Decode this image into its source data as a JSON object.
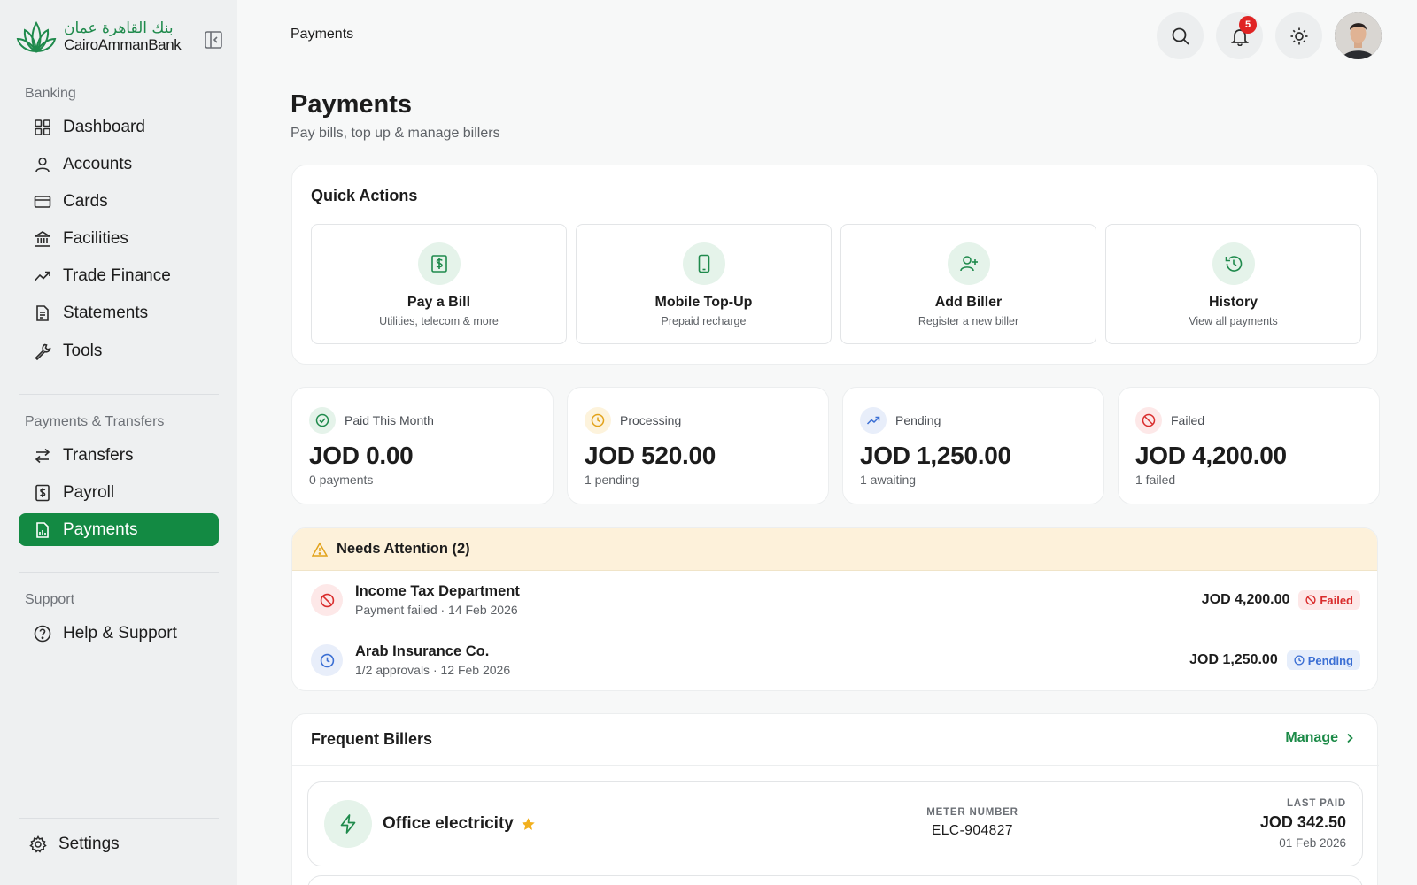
{
  "brand": {
    "name_ar": "بنك القاهرة عمان",
    "name_en": "CairoAmmanBank",
    "accent": "#138a43"
  },
  "sidebar": {
    "sections": [
      {
        "heading": "Banking",
        "items": [
          {
            "label": "Dashboard",
            "icon": "grid-icon"
          },
          {
            "label": "Accounts",
            "icon": "user-icon"
          },
          {
            "label": "Cards",
            "icon": "card-icon"
          },
          {
            "label": "Facilities",
            "icon": "bank-icon"
          },
          {
            "label": "Trade Finance",
            "icon": "trend-icon"
          },
          {
            "label": "Statements",
            "icon": "document-icon"
          },
          {
            "label": "Tools",
            "icon": "wrench-icon"
          }
        ]
      },
      {
        "heading": "Payments & Transfers",
        "items": [
          {
            "label": "Transfers",
            "icon": "arrows-icon"
          },
          {
            "label": "Payroll",
            "icon": "payroll-icon"
          },
          {
            "label": "Payments",
            "icon": "payments-icon",
            "active": true
          }
        ]
      },
      {
        "heading": "Support",
        "items": [
          {
            "label": "Help & Support",
            "icon": "help-icon"
          }
        ]
      }
    ],
    "settings_label": "Settings"
  },
  "header": {
    "breadcrumb": "Payments",
    "notifications_count": "5"
  },
  "page": {
    "title": "Payments",
    "subtitle": "Pay bills, top up & manage billers"
  },
  "quick_actions": {
    "title": "Quick Actions",
    "items": [
      {
        "label": "Pay a Bill",
        "sub": "Utilities, telecom & more",
        "icon": "bill-icon"
      },
      {
        "label": "Mobile Top-Up",
        "sub": "Prepaid recharge",
        "icon": "phone-icon"
      },
      {
        "label": "Add Biller",
        "sub": "Register a new biller",
        "icon": "add-user-icon"
      },
      {
        "label": "History",
        "sub": "View all payments",
        "icon": "history-icon"
      }
    ]
  },
  "stats": [
    {
      "label": "Paid This Month",
      "value": "JOD 0.00",
      "sub": "0 payments",
      "color": "#1f8a4c"
    },
    {
      "label": "Processing",
      "value": "JOD 520.00",
      "sub": "1 pending",
      "color": "#e2a21a"
    },
    {
      "label": "Pending",
      "value": "JOD 1,250.00",
      "sub": "1 awaiting",
      "color": "#3b6fd4"
    },
    {
      "label": "Failed",
      "value": "JOD 4,200.00",
      "sub": "1 failed",
      "color": "#d92d2d"
    }
  ],
  "attention": {
    "title": "Needs Attention (2)",
    "items": [
      {
        "name": "Income Tax Department",
        "meta": "Payment failed · 14 Feb 2026",
        "amount": "JOD 4,200.00",
        "status": "Failed"
      },
      {
        "name": "Arab Insurance Co.",
        "meta": "1/2 approvals · 12 Feb 2026",
        "amount": "JOD 1,250.00",
        "status": "Pending"
      }
    ]
  },
  "billers": {
    "title": "Frequent Billers",
    "manage_label": "Manage",
    "items": [
      {
        "name": "Office electricity",
        "favorite": true,
        "meter_label": "METER NUMBER",
        "meter_value": "ELC-904827",
        "last_label": "LAST PAID",
        "last_amount": "JOD 342.50",
        "last_date": "01 Feb 2026"
      }
    ]
  }
}
